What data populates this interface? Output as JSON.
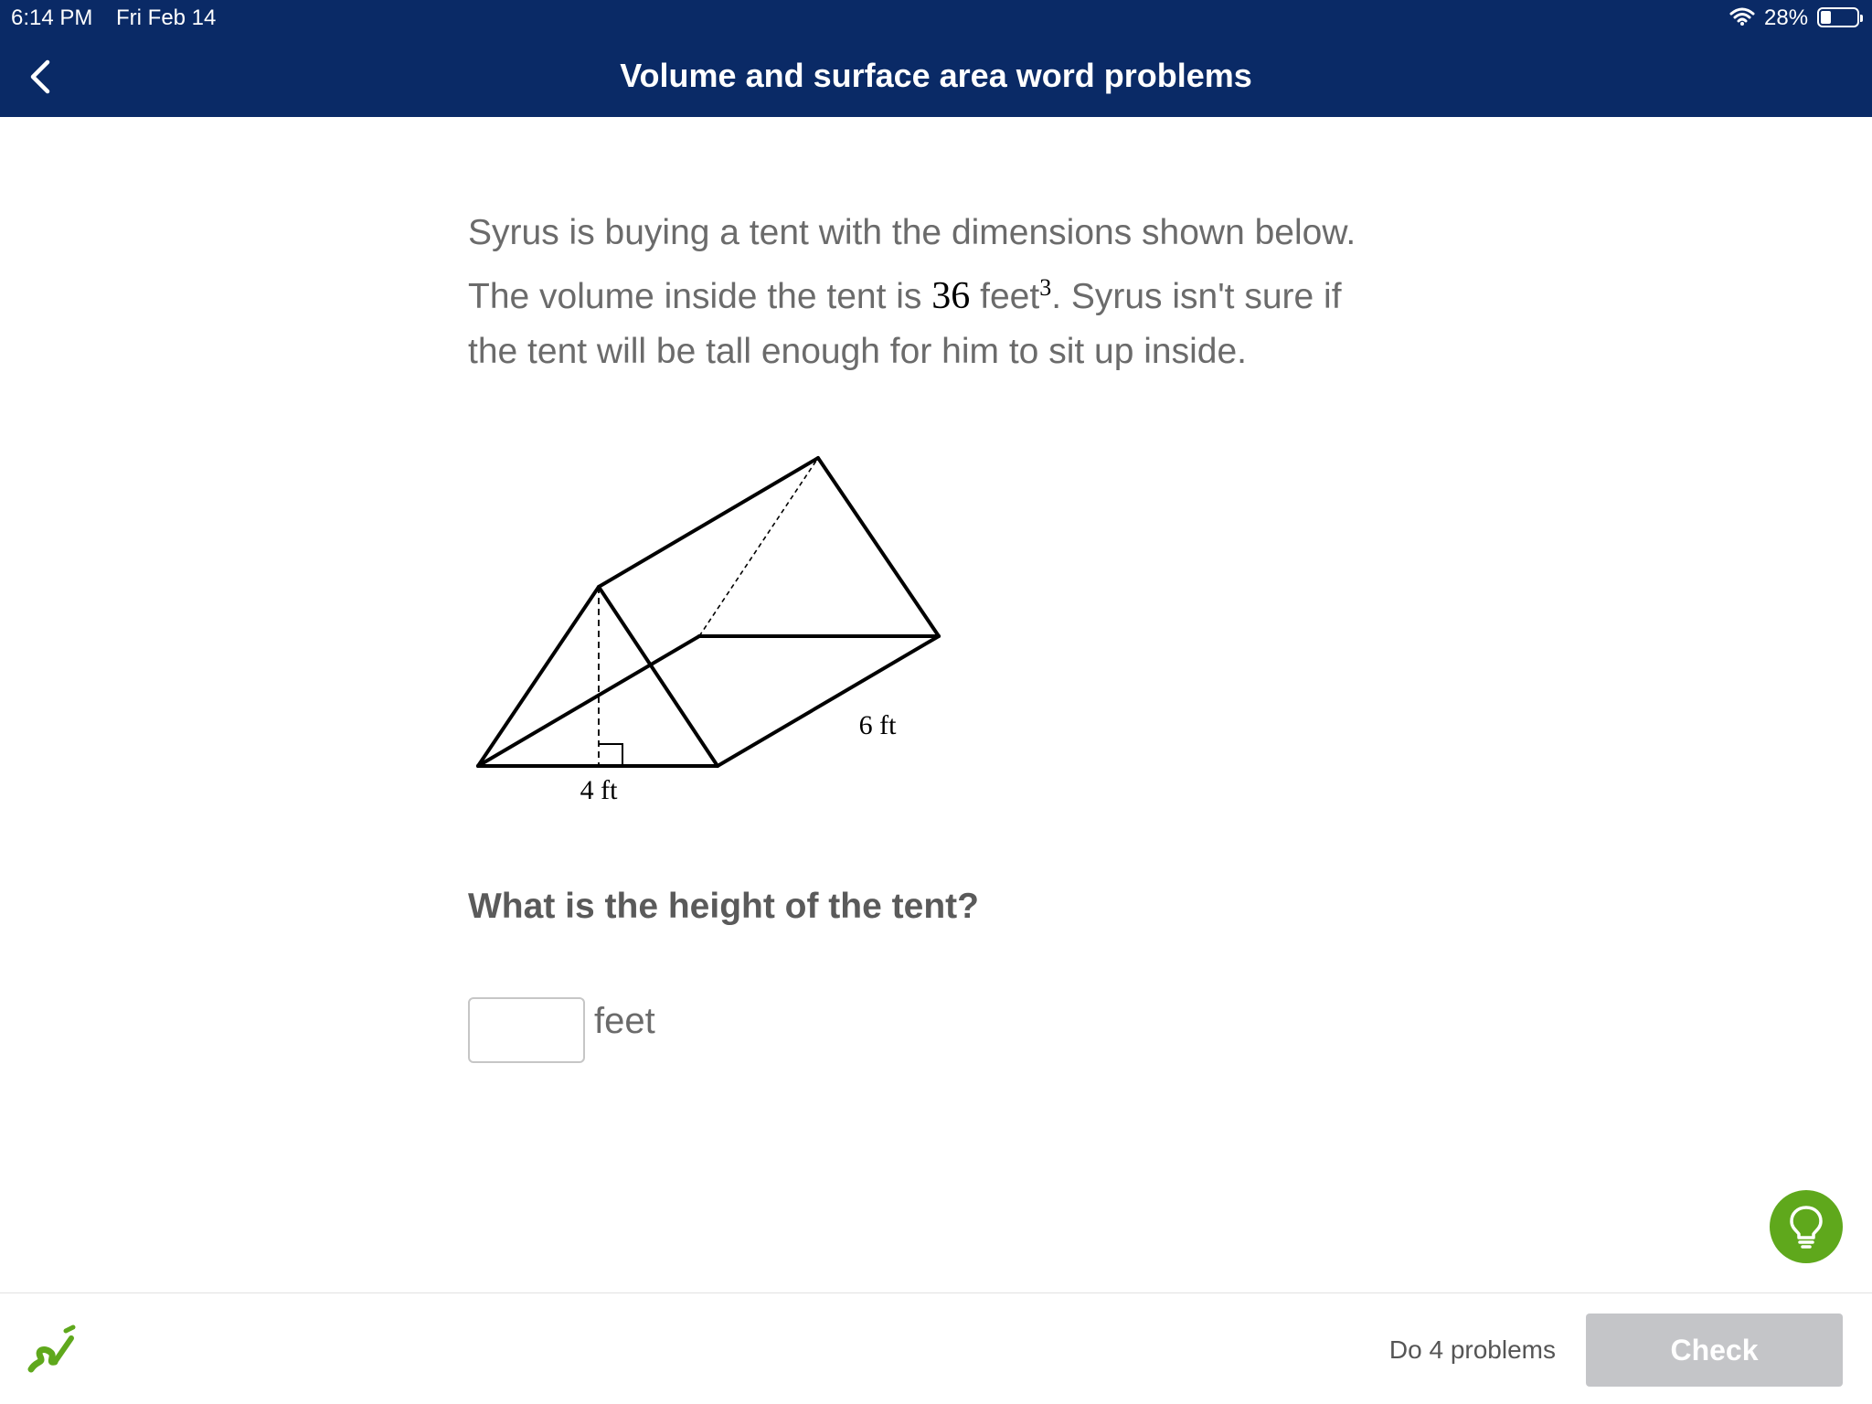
{
  "status_bar": {
    "time": "6:14 PM",
    "date": "Fri Feb 14",
    "battery": "28%",
    "battery_level": 0.28
  },
  "nav": {
    "title": "Volume and surface area word problems",
    "back_icon": "chevron-left-icon"
  },
  "question": {
    "line1": "Syrus is buying a tent with the dimensions shown below.",
    "line2_pre": "The volume inside the tent is ",
    "volume_value": "36",
    "volume_unit": "feet",
    "volume_exp": "3",
    "line2_post": ". Syrus isn't sure if",
    "line3": "the tent will be tall enough for him to sit up inside."
  },
  "figure": {
    "base_label": "4 ft",
    "length_label": "6 ft"
  },
  "prompt": "What is the height of the tent?",
  "answer": {
    "value": "",
    "unit": "feet"
  },
  "footer": {
    "progress_text": "Do 4 problems",
    "check_label": "Check",
    "hint_icon": "lightbulb-icon",
    "logo_icon": "khan-leaf-logo-icon"
  },
  "colors": {
    "nav_bg": "#0a2a66",
    "hint_green": "#5fa81c",
    "check_disabled": "#c4c5c8"
  }
}
